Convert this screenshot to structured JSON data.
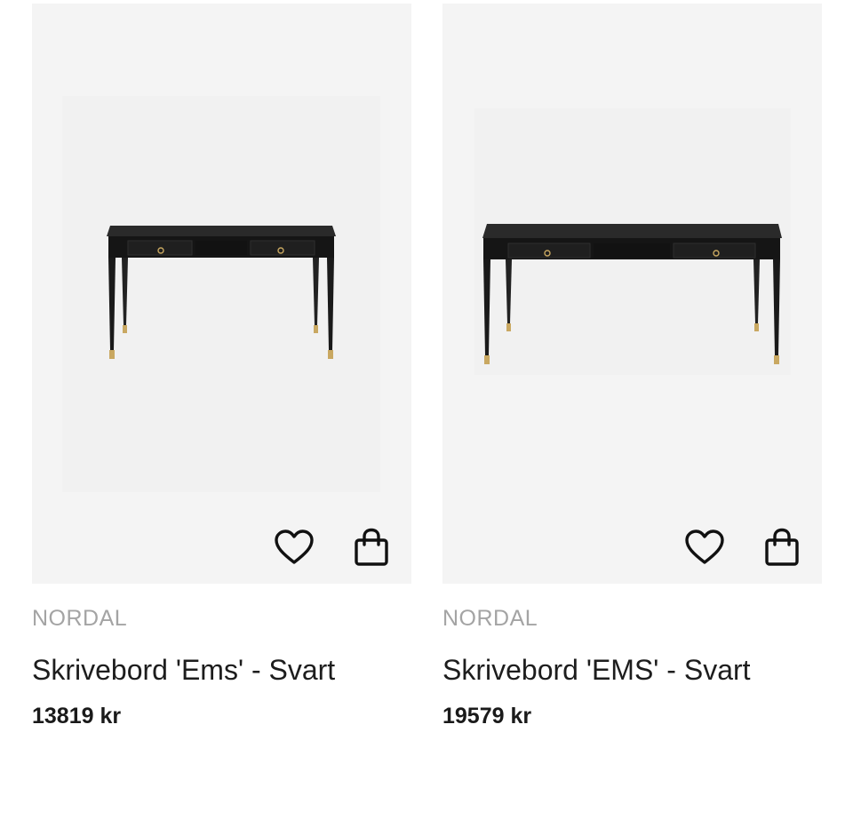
{
  "products": [
    {
      "brand": "NORDAL",
      "title": "Skrivebord 'Ems' - Svart",
      "price": "13819 kr",
      "favorite_icon": "heart-icon",
      "cart_icon": "shopping-bag-icon"
    },
    {
      "brand": "NORDAL",
      "title": "Skrivebord 'EMS' - Svart",
      "price": "19579 kr",
      "favorite_icon": "heart-icon",
      "cart_icon": "shopping-bag-icon"
    }
  ],
  "colors": {
    "image_background": "#f4f4f4",
    "brand_text": "#a4a4a4",
    "desk_body": "#1c1c1c",
    "brass_feet": "#c9a861"
  }
}
